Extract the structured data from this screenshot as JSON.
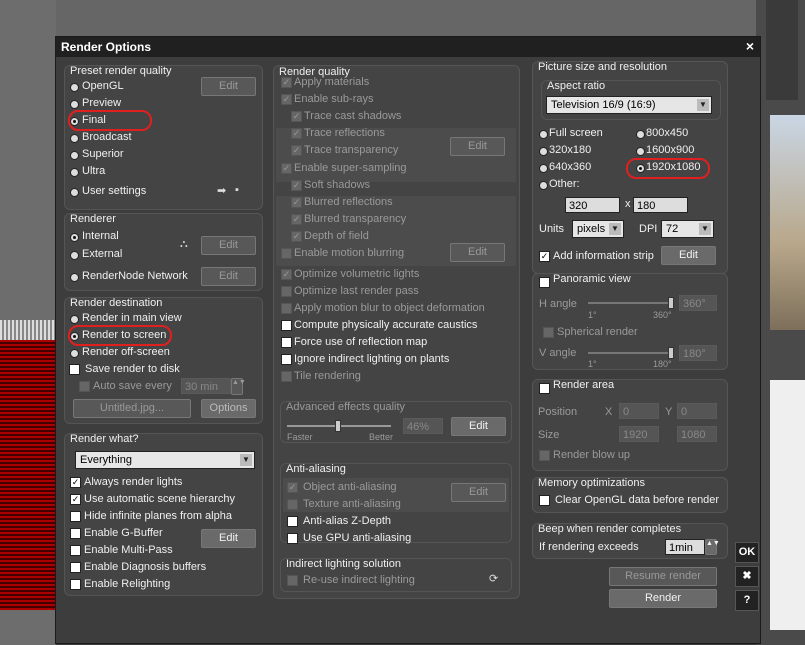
{
  "window": {
    "title": "Render Options",
    "close_glyph": "×"
  },
  "preset": {
    "title": "Preset render quality",
    "options": [
      "OpenGL",
      "Preview",
      "Final",
      "Broadcast",
      "Superior",
      "Ultra",
      "User settings"
    ],
    "selected": "Final",
    "edit_label": "Edit"
  },
  "renderer": {
    "title": "Renderer",
    "internal": "Internal",
    "external": "External",
    "rendernode": "RenderNode Network",
    "edit_label": "Edit",
    "selected": "Internal"
  },
  "destination": {
    "title": "Render destination",
    "main_view": "Render in main view",
    "to_screen": "Render to screen",
    "off_screen": "Render off-screen",
    "save_to_disk": "Save render to disk",
    "auto_save": "Auto save every",
    "auto_save_value": "30 min",
    "filename": "Untitled.jpg...",
    "options_label": "Options",
    "selected": "Render to screen"
  },
  "render_what": {
    "title": "Render what?",
    "selected": "Everything",
    "items": [
      {
        "label": "Always render lights",
        "checked": true
      },
      {
        "label": "Use automatic scene hierarchy",
        "checked": true
      },
      {
        "label": "Hide infinite planes from alpha",
        "checked": false
      },
      {
        "label": "Enable G-Buffer",
        "checked": false
      },
      {
        "label": "Enable Multi-Pass",
        "checked": false
      },
      {
        "label": "Enable Diagnosis buffers",
        "checked": false
      },
      {
        "label": "Enable Relighting",
        "checked": false
      }
    ],
    "edit_label": "Edit"
  },
  "quality": {
    "title": "Render quality",
    "items": [
      {
        "label": "Apply materials",
        "checked": true,
        "enabled": false
      },
      {
        "label": "Enable sub-rays",
        "checked": true,
        "enabled": false
      },
      {
        "label": "Trace cast shadows",
        "checked": true,
        "enabled": false
      },
      {
        "label": "Trace reflections",
        "checked": true,
        "enabled": false
      },
      {
        "label": "Trace transparency",
        "checked": true,
        "enabled": false
      },
      {
        "label": "Enable super-sampling",
        "checked": true,
        "enabled": false
      },
      {
        "label": "Soft shadows",
        "checked": true,
        "enabled": false
      },
      {
        "label": "Blurred reflections",
        "checked": true,
        "enabled": false
      },
      {
        "label": "Blurred transparency",
        "checked": true,
        "enabled": false
      },
      {
        "label": "Depth of field",
        "checked": true,
        "enabled": false
      },
      {
        "label": "Enable motion blurring",
        "checked": false,
        "enabled": false
      },
      {
        "label": "Optimize volumetric lights",
        "checked": true,
        "enabled": false
      },
      {
        "label": "Optimize last render pass",
        "checked": false,
        "enabled": false
      },
      {
        "label": "Apply motion blur to object deformation",
        "checked": false,
        "enabled": false
      },
      {
        "label": "Compute physically accurate caustics",
        "checked": false,
        "enabled": true
      },
      {
        "label": "Force use of reflection map",
        "checked": false,
        "enabled": true
      },
      {
        "label": "Ignore indirect lighting on plants",
        "checked": false,
        "enabled": true
      },
      {
        "label": "Tile rendering",
        "checked": false,
        "enabled": false
      }
    ],
    "edit_label": "Edit",
    "advanced_title": "Advanced effects quality",
    "faster": "Faster",
    "better": "Better",
    "percent": "46%",
    "percent_value": 0.46
  },
  "antialiasing": {
    "title": "Anti-aliasing",
    "object": "Object anti-aliasing",
    "texture": "Texture anti-aliasing",
    "zdepth": "Anti-alias Z-Depth",
    "gpu": "Use GPU anti-aliasing",
    "edit_label": "Edit"
  },
  "indirect": {
    "title": "Indirect lighting solution",
    "reuse": "Re-use indirect lighting"
  },
  "picture": {
    "title": "Picture size and resolution",
    "aspect_title": "Aspect ratio",
    "aspect_value": "Television 16/9 (16:9)",
    "sizes": [
      "Full screen",
      "800x450",
      "320x180",
      "1600x900",
      "640x360",
      "1920x1080",
      "Other:"
    ],
    "selected": "1920x1080",
    "width": "320",
    "height": "180",
    "x_sep": "x",
    "units_label": "Units",
    "units_value": "pixels",
    "dpi_label": "DPI",
    "dpi_value": "72",
    "info_strip": "Add information strip",
    "edit_label": "Edit"
  },
  "panoramic": {
    "title": "Panoramic view",
    "h_angle": "H angle",
    "h_min": "1°",
    "h_max": "360°",
    "h_value": "360°",
    "spherical": "Spherical render",
    "v_angle": "V angle",
    "v_min": "1°",
    "v_max": "180°",
    "v_value": "180°"
  },
  "area": {
    "title": "Render area",
    "position": "Position",
    "size": "Size",
    "x": "X",
    "y": "Y",
    "pos_x": "0",
    "pos_y": "0",
    "size_w": "1920",
    "size_h": "1080",
    "blow_up": "Render blow up"
  },
  "memory": {
    "title": "Memory optimizations",
    "clear": "Clear OpenGL data before render"
  },
  "beep": {
    "title": "Beep when render completes",
    "label": "If rendering exceeds",
    "value": "1min"
  },
  "actions": {
    "resume": "Resume render",
    "render": "Render",
    "ok": "OK",
    "cancel": "✖",
    "help": "?"
  }
}
